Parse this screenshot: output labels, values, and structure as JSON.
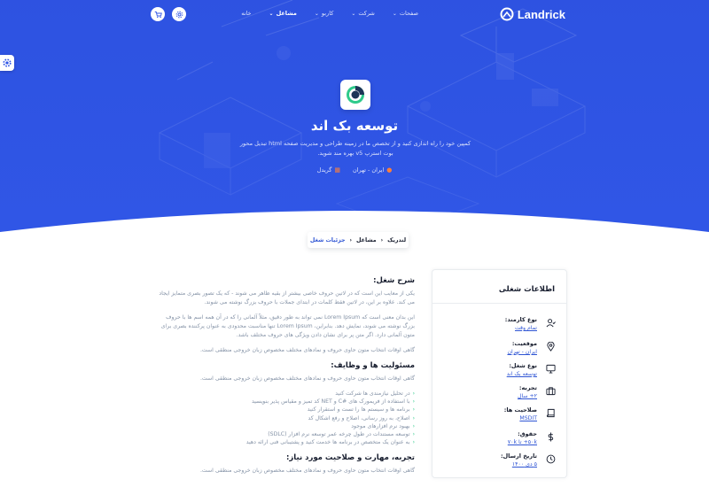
{
  "brand": {
    "name": "Landrick"
  },
  "nav": {
    "items": [
      {
        "label": "خانه",
        "active": false,
        "has_dropdown": false
      },
      {
        "label": "مشاغل",
        "active": true,
        "has_dropdown": true
      },
      {
        "label": "کاربو",
        "active": false,
        "has_dropdown": true
      },
      {
        "label": "شرکت",
        "active": false,
        "has_dropdown": true
      },
      {
        "label": "صفحات",
        "active": false,
        "has_dropdown": true
      }
    ],
    "icons": [
      "cart-icon",
      "settings-icon"
    ]
  },
  "hero": {
    "title": "توسعه بک اند",
    "description": "کمپین خود را راه اندازی کنید و از تخصص ما در زمینه طراحی و مدیریت صفحه html تبدیل محور بوت استرپ v5 بهره مند شوید.",
    "location": "ایران - تهران",
    "type": "گریدل"
  },
  "breadcrumb": {
    "items": [
      "لندریک",
      "مشاغل",
      "جزئیات شغل"
    ]
  },
  "content": {
    "description_title": "شرح شغل:",
    "paragraphs": [
      "یکی از معایب این است که در لاتین حروف خاصی بیشتر از بقیه ظاهر می شوند - که یک تصور بصری متمایز ایجاد می کند. علاوه بر این، در لاتین فقط کلمات در ابتدای جملات با حروف بزرگ نوشته می شوند.",
      "این بدان معنی است که Lorem Ipsum نمی تواند به طور دقیق، مثلاً آلمانی را که در آن همه اسم ها با حروف بزرگ نوشته می شوند، نمایش دهد. بنابراین، Lorem Ipsum تنها مناسبت محدودی به عنوان پرکننده بصری برای متون آلمانی دارد. اگر متن پر برای نشان دادن ویژگی های حروف مختلف باشد.",
      "گاهی اوقات انتخاب متون حاوی حروف و نمادهای مختلف مخصوص زبان خروجی منطقی است."
    ],
    "responsibilities_title": "مسئولیت ها و وظایف:",
    "responsibilities_intro": "گاهی اوقات انتخاب متون حاوی حروف و نمادهای مختلف مخصوص زبان خروجی منطقی است.",
    "responsibilities": [
      "در تحلیل نیازمندی ها شرکت کنید",
      "با استفاده از فریمورک های #C و NET کد تمیز و مقیاس پذیر بنویسید",
      "برنامه ها و سیستم ها را تست و استقرار کنید",
      "اصلاح، به روز رسانی، اصلاح و رفع اشکال کد",
      "بهبود نرم افزارهای موجود",
      "توسعه مستندات در طول چرخه عمر توسعه نرم افزار (SDLC)",
      "به عنوان یک متخصص در برنامه ها خدمت کنید و پشتیبانی فنی ارائه دهید"
    ],
    "experience_title": "تجربه، مهارت و صلاحیت مورد نیاز:",
    "experience_intro": "گاهی اوقات انتخاب متون حاوی حروف و نمادهای مختلف مخصوص زبان خروجی منطقی است."
  },
  "sidebar": {
    "title": "اطلاعات شغلی",
    "items": [
      {
        "label": "نوع کارمند:",
        "value": "تمام وقت",
        "icon": "user-check-icon"
      },
      {
        "label": "موقعیت:",
        "value": "ایران - تهران",
        "icon": "map-pin-icon"
      },
      {
        "label": "نوع شغل:",
        "value": "توسعه بک اند",
        "icon": "monitor-icon"
      },
      {
        "label": "تجربه:",
        "value": "۲+ سال",
        "icon": "briefcase-icon"
      },
      {
        "label": "صلاحیت ها:",
        "value": "MSDIT",
        "icon": "book-icon"
      },
      {
        "label": "حقوق:",
        "value": "۵۰k+ تا ۷۰k",
        "icon": "dollar-icon"
      },
      {
        "label": "تاریخ ارسال:",
        "value": "۵ دی ۱۴۰۰",
        "icon": "clock-icon"
      }
    ]
  },
  "colors": {
    "primary": "#2f55d4",
    "hero": "#3056e6",
    "accent": "#2eca8b",
    "orange": "#ff7f3a"
  }
}
